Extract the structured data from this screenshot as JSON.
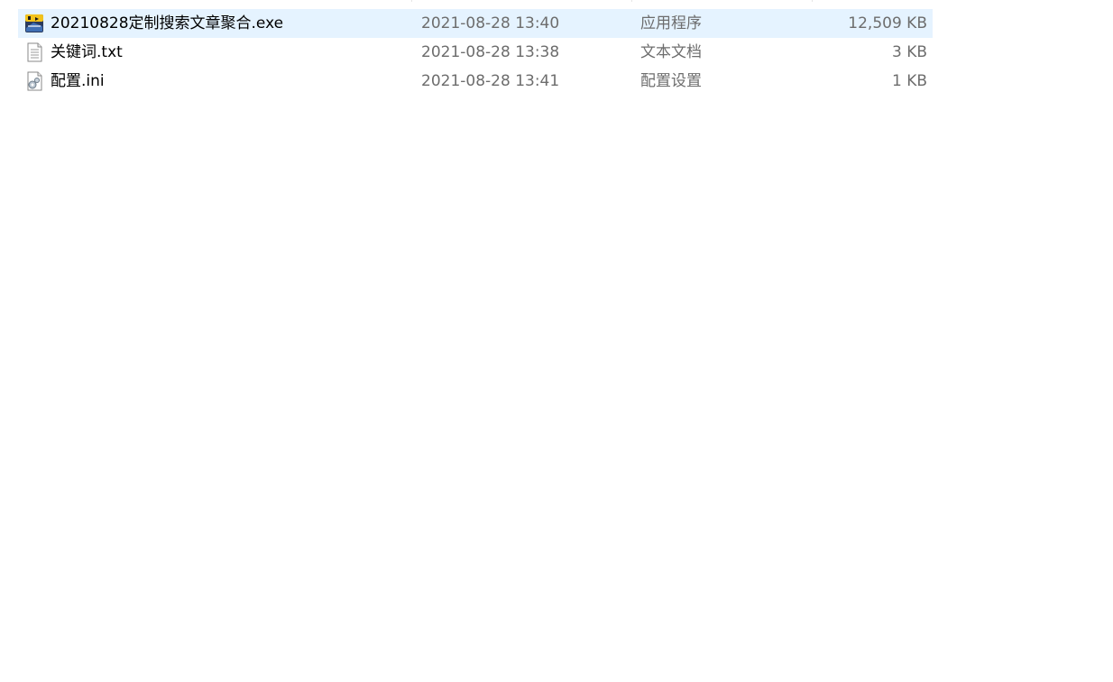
{
  "files": [
    {
      "name": "20210828定制搜索文章聚合.exe",
      "modified": "2021-08-28 13:40",
      "type": "应用程序",
      "size": "12,509 KB",
      "icon": "exe-app-icon",
      "selected": true
    },
    {
      "name": "关键词.txt",
      "modified": "2021-08-28 13:38",
      "type": "文本文档",
      "size": "3 KB",
      "icon": "text-document-icon",
      "selected": false
    },
    {
      "name": "配置.ini",
      "modified": "2021-08-28 13:41",
      "type": "配置设置",
      "size": "1 KB",
      "icon": "config-settings-icon",
      "selected": false
    }
  ],
  "colors": {
    "selection_bg": "#e5f3ff",
    "secondary_text": "#6d6d6d",
    "primary_text": "#000000"
  }
}
